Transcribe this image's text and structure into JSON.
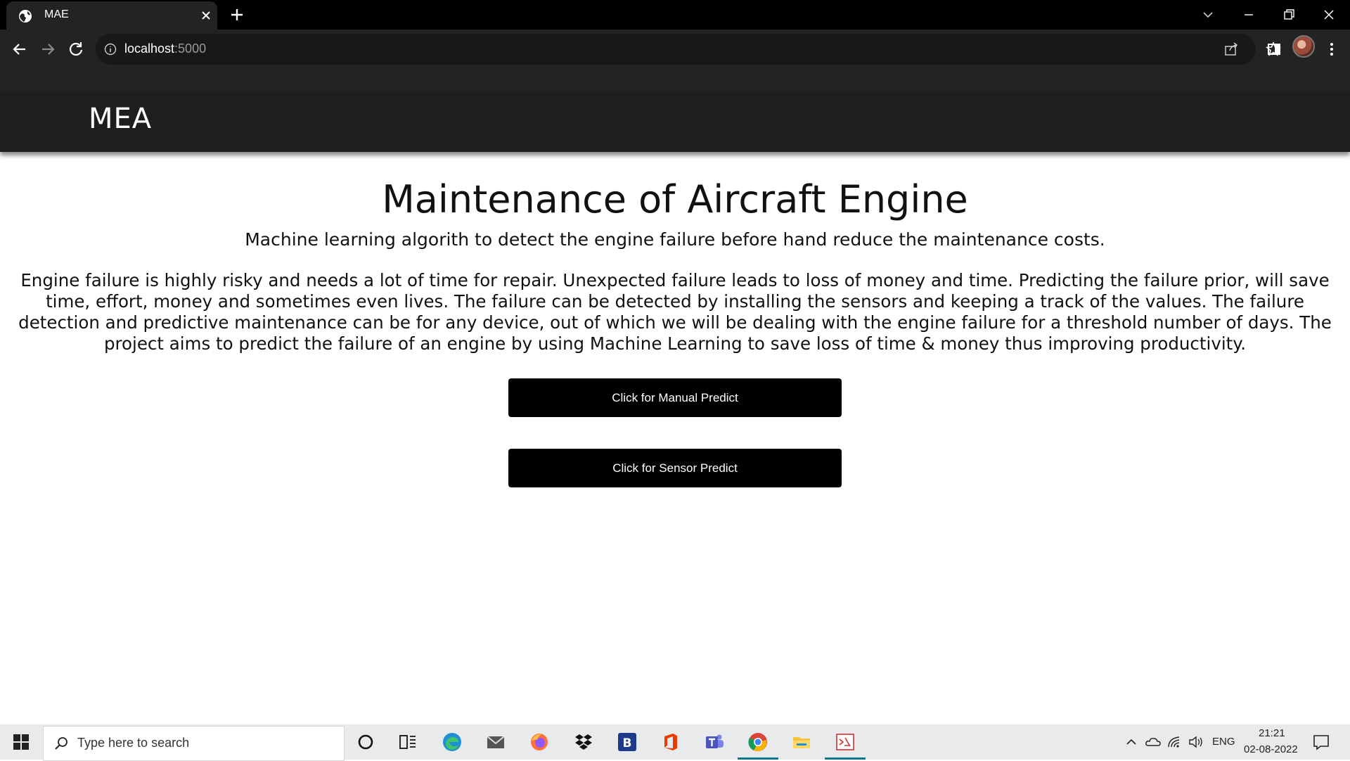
{
  "browser": {
    "tab_title": "MAE",
    "url_host": "localhost",
    "url_port": ":5000"
  },
  "page": {
    "brand": "MEA",
    "heading": "Maintenance of Aircraft Engine",
    "subheading": "Machine learning algorith to detect the engine failure before hand reduce the maintenance costs.",
    "description": "Engine failure is highly risky and needs a lot of time for repair. Unexpected failure leads to loss of money and time. Predicting the failure prior, will save time, effort, money and sometimes even lives. The failure can be detected by installing the sensors and keeping a track of the values. The failure detection and predictive maintenance can be for any device, out of which we will be dealing with the engine failure for a threshold number of days. The project aims to predict the failure of an engine by using Machine Learning to save loss of time & money thus improving productivity.",
    "buttons": {
      "manual": "Click for Manual Predict",
      "sensor": "Click for Sensor Predict"
    }
  },
  "taskbar": {
    "search_placeholder": "Type here to search",
    "language": "ENG",
    "time": "21:21",
    "date": "02-08-2022",
    "pinned": [
      "cortana-icon",
      "task-view-icon",
      "edge-icon",
      "mail-icon",
      "firefox-icon",
      "dropbox-icon",
      "b-app-icon",
      "office-icon",
      "teams-icon",
      "chrome-icon",
      "file-explorer-icon",
      "code-app-icon"
    ]
  },
  "colors": {
    "navbar": "#1e1e1e",
    "button": "#000000",
    "taskbar": "#e9eaeb",
    "chrome_toolbar": "#232323"
  }
}
